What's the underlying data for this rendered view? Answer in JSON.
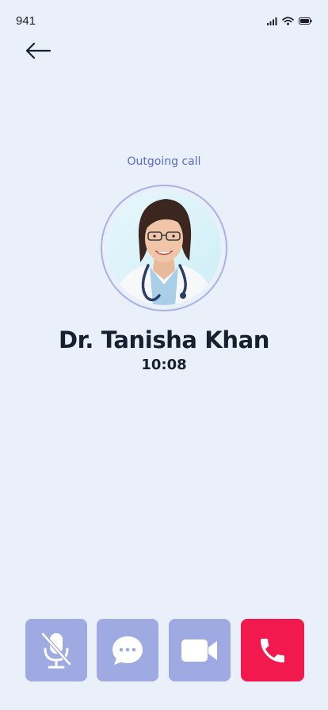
{
  "status_bar": {
    "time": "941",
    "icons": [
      "signal-icon",
      "wifi-icon",
      "battery-icon"
    ]
  },
  "header": {
    "back_icon": "back-arrow-icon"
  },
  "call": {
    "status": "Outgoing call",
    "contact_name": "Dr. Tanisha Khan",
    "timer": "10:08"
  },
  "controls": [
    {
      "name": "mute",
      "icon": "mic-off-icon"
    },
    {
      "name": "chat",
      "icon": "chat-bubble-icon"
    },
    {
      "name": "video",
      "icon": "video-camera-icon"
    },
    {
      "name": "end-call",
      "icon": "phone-icon"
    }
  ],
  "colors": {
    "background": "#e9f0fa",
    "accent_text": "#5c6bc0",
    "control_bg": "#9fa9e2",
    "end_call_bg": "#f2194f",
    "text_primary": "#17202e",
    "avatar_ring": "#a8b2e8"
  }
}
